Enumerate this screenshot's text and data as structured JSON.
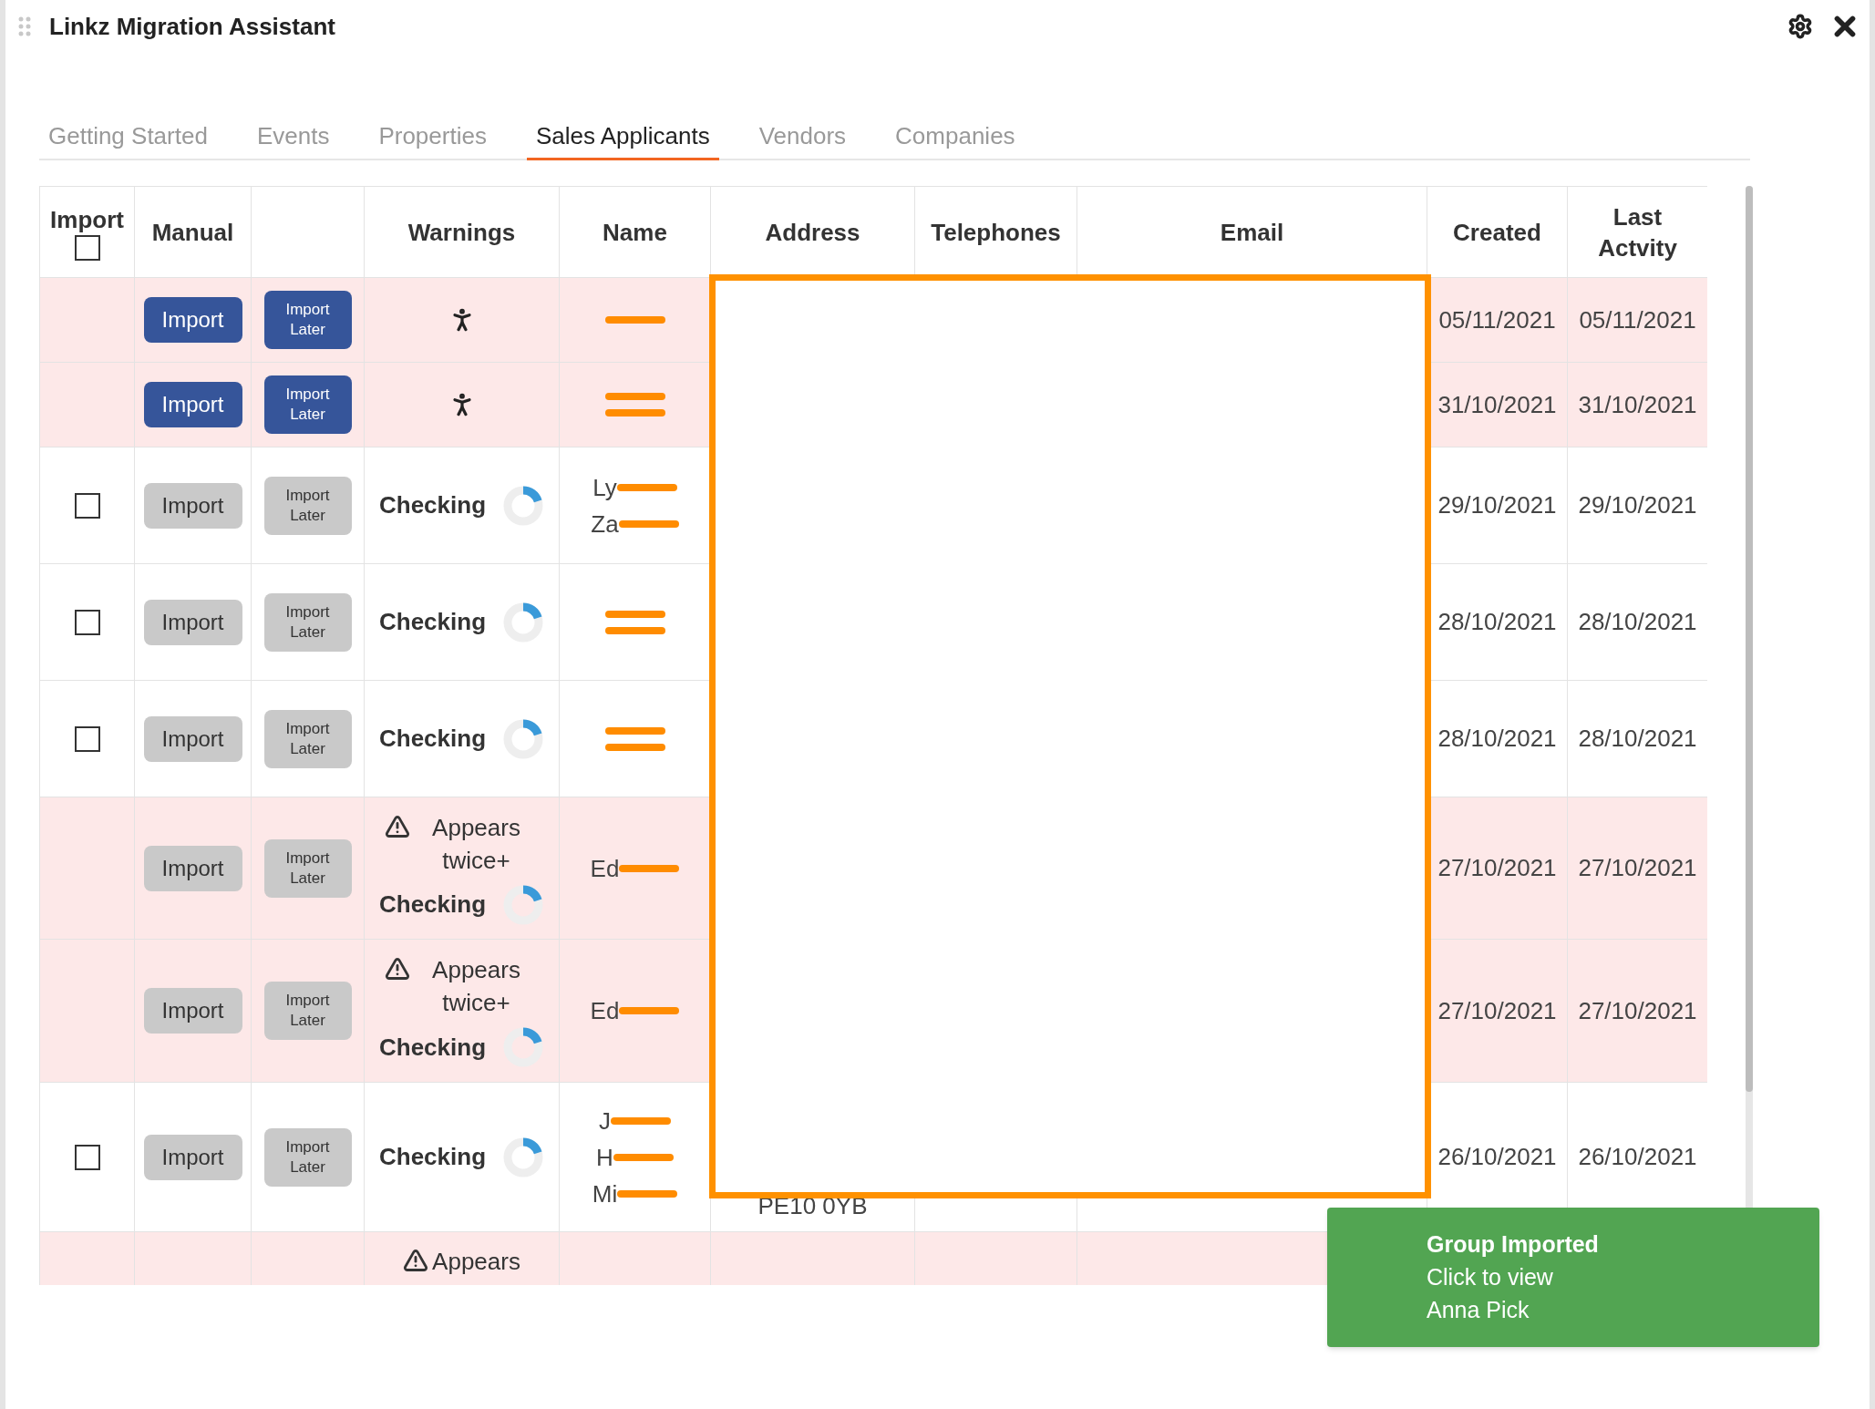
{
  "window": {
    "title": "Linkz Migration Assistant"
  },
  "tabs": [
    {
      "label": "Getting Started",
      "selected": false
    },
    {
      "label": "Events",
      "selected": false
    },
    {
      "label": "Properties",
      "selected": false
    },
    {
      "label": "Sales Applicants",
      "selected": true
    },
    {
      "label": "Vendors",
      "selected": false
    },
    {
      "label": "Companies",
      "selected": false
    }
  ],
  "table": {
    "columns": [
      {
        "label": "Import",
        "select_all": {
          "checked": false
        }
      },
      {
        "label": "Manual"
      },
      {},
      {
        "label": "Warnings"
      },
      {
        "label": "Name"
      },
      {
        "label": "Address"
      },
      {
        "label": "Telephones"
      },
      {
        "label": "Email"
      },
      {
        "label": "Created"
      },
      {
        "label": "Last Actvity"
      }
    ],
    "rows": [
      {
        "flagged": true,
        "active": true,
        "import": "Import",
        "import_later": "Import Later",
        "warnings": [
          {
            "kind": "person"
          }
        ],
        "name_redacted": true,
        "created": "05/11/2021",
        "last_activity": "05/11/2021"
      },
      {
        "flagged": true,
        "active": true,
        "import": "Import",
        "import_later": "Import Later",
        "warnings": [
          {
            "kind": "person"
          }
        ],
        "name_redacted": true,
        "created": "31/10/2021",
        "last_activity": "31/10/2021"
      },
      {
        "flagged": false,
        "checked": false,
        "active": false,
        "import": "Import",
        "import_later": "Import Later",
        "warnings": [
          {
            "kind": "checking",
            "text": "Checking"
          }
        ],
        "name_redacted": true,
        "name_fragments": [
          "Ly",
          "Za"
        ],
        "created": "29/10/2021",
        "last_activity": "29/10/2021"
      },
      {
        "flagged": false,
        "checked": false,
        "active": false,
        "import": "Import",
        "import_later": "Import Later",
        "warnings": [
          {
            "kind": "checking",
            "text": "Checking"
          }
        ],
        "name_redacted": true,
        "created": "28/10/2021",
        "last_activity": "28/10/2021"
      },
      {
        "flagged": false,
        "checked": false,
        "active": false,
        "import": "Import",
        "import_later": "Import Later",
        "warnings": [
          {
            "kind": "checking",
            "text": "Checking"
          }
        ],
        "name_redacted": true,
        "created": "28/10/2021",
        "last_activity": "28/10/2021"
      },
      {
        "flagged": true,
        "active": false,
        "import": "Import",
        "import_later": "Import Later",
        "warnings": [
          {
            "kind": "duplicate",
            "text": "Appears twice+"
          },
          {
            "kind": "checking",
            "text": "Checking"
          }
        ],
        "name_redacted": true,
        "name_fragments": [
          "Ed"
        ],
        "created": "27/10/2021",
        "last_activity": "27/10/2021"
      },
      {
        "flagged": true,
        "active": false,
        "import": "Import",
        "import_later": "Import Later",
        "warnings": [
          {
            "kind": "duplicate",
            "text": "Appears twice+"
          },
          {
            "kind": "checking",
            "text": "Checking"
          }
        ],
        "name_redacted": true,
        "name_fragments": [
          "Ed"
        ],
        "created": "27/10/2021",
        "last_activity": "27/10/2021"
      },
      {
        "flagged": false,
        "checked": false,
        "active": false,
        "import": "Import",
        "import_later": "Import Later",
        "warnings": [
          {
            "kind": "checking",
            "text": "Checking"
          }
        ],
        "name_redacted": true,
        "name_fragments": [
          "J",
          "H",
          "Mi"
        ],
        "address": "PE10 0YB",
        "created": "26/10/2021",
        "last_activity": "26/10/2021"
      },
      {
        "flagged": true,
        "warnings": [
          {
            "kind": "duplicate",
            "text": "Appears"
          }
        ]
      }
    ]
  },
  "toast": {
    "title": "Group Imported",
    "lines": [
      "Click to view",
      "Anna Pick"
    ]
  }
}
